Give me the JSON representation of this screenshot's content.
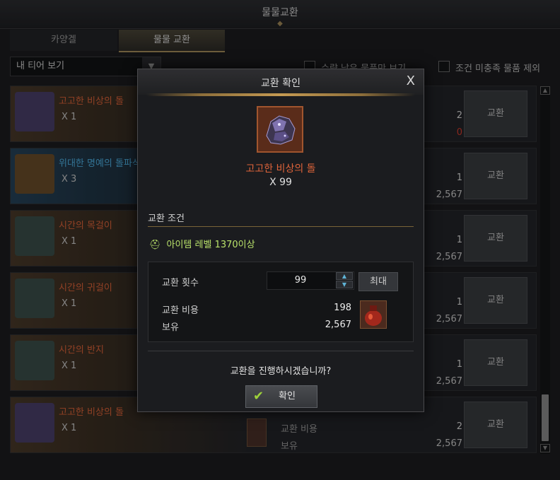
{
  "window": {
    "title": "물물교환"
  },
  "tabs": [
    {
      "label": "카양겔"
    },
    {
      "label": "물물 교환"
    }
  ],
  "filter": {
    "tier_select": "내 티어 보기",
    "checkbox1": "수량 남은 물품만 보기",
    "checkbox2": "조건 미충족 물품 제외"
  },
  "list": {
    "cost_label": "교환 비용",
    "hold_label": "보유",
    "button_label": "교환",
    "rows": [
      {
        "name": "고고한 비상의 돌",
        "qty": "X 1",
        "cost": "2",
        "hold": "0",
        "name_color": "#e0643a",
        "hold_color": "#d33c2e"
      },
      {
        "name": "위대한 명예의 돌파석(귀속)",
        "qty": "X 3",
        "cost": "1",
        "hold": "2,567",
        "name_color": "#4fb3e6",
        "hold_color": "#cccccc"
      },
      {
        "name": "시간의 목걸이",
        "qty": "X 1",
        "cost": "1",
        "hold": "2,567",
        "name_color": "#e0643a",
        "hold_color": "#cccccc"
      },
      {
        "name": "시간의 귀걸이",
        "qty": "X 1",
        "cost": "1",
        "hold": "2,567",
        "name_color": "#e0643a",
        "hold_color": "#cccccc"
      },
      {
        "name": "시간의 반지",
        "qty": "X 1",
        "cost": "1",
        "hold": "2,567",
        "name_color": "#e0643a",
        "hold_color": "#cccccc"
      },
      {
        "name": "고고한 비상의 돌",
        "qty": "X 1",
        "cost": "2",
        "hold": "2,567",
        "name_color": "#e0643a",
        "hold_color": "#cccccc"
      }
    ]
  },
  "modal": {
    "title": "교환 확인",
    "close": "X",
    "item_name": "고고한 비상의 돌",
    "item_qty": "X 99",
    "condition_label": "교환 조건",
    "condition": "아이템 레벨 1370이상",
    "count_label": "교환 횟수",
    "count_value": "99",
    "max_label": "최대",
    "cost_label": "교환 비용",
    "cost_value": "198",
    "hold_label": "보유",
    "hold_value": "2,567",
    "question": "교환을 진행하시겠습니까?",
    "confirm_label": "확인"
  },
  "colors": {
    "accent": "#a88f5c",
    "legendary": "#e0643a",
    "epic": "#4fb3e6",
    "condition": "#b9e26a"
  }
}
